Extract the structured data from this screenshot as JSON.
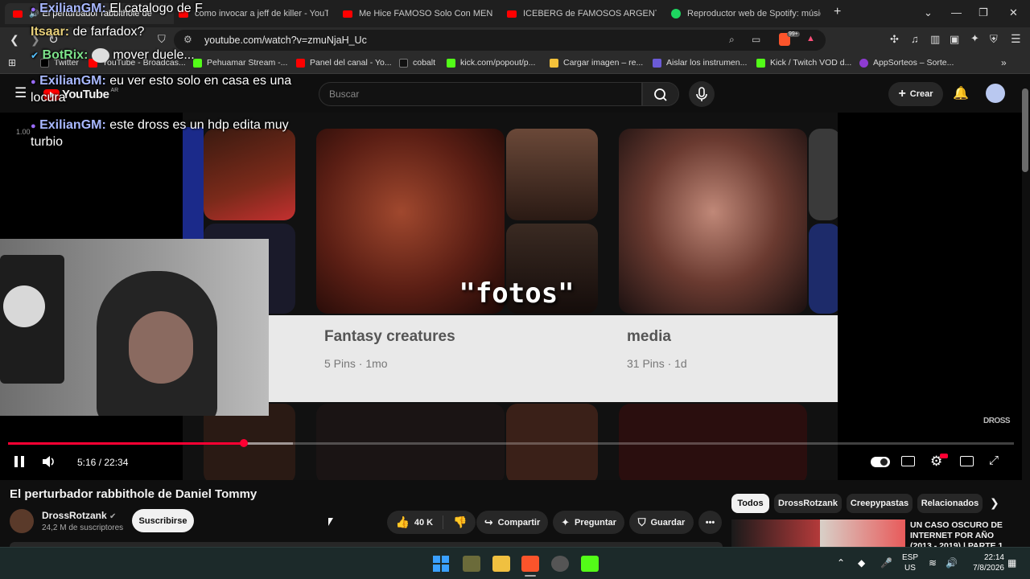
{
  "browser": {
    "tabs": [
      {
        "label": "El perturbador rabbithole de",
        "active": true
      },
      {
        "label": "como invocar a jeff de killer - YouTub",
        "active": false
      },
      {
        "label": "Me Hice FAMOSO Solo Con MENTIR",
        "active": false
      },
      {
        "label": "ICEBERG de FAMOSOS ARGENTINOS",
        "active": false
      },
      {
        "label": "Reproductor web de Spotify: música",
        "active": false
      }
    ],
    "url": "youtube.com/watch?v=zmuNjaH_Uc",
    "bookmarks": [
      "Twitter",
      "YouTube - Broadcas...",
      "Pehuamar Stream -...",
      "Panel del canal - Yo...",
      "cobalt",
      "kick.com/popout/p...",
      "Cargar imagen – re...",
      "Aislar los instrumen...",
      "Kick / Twitch VOD d...",
      "AppSorteos – Sorte..."
    ],
    "extension_badge": "99+"
  },
  "youtube": {
    "logo_text": "YouTube",
    "logo_country": "AR",
    "search_placeholder": "Buscar",
    "create_label": "Crear"
  },
  "chat_overlay": [
    {
      "user": "ExilianGM",
      "text": "El catalogo de F"
    },
    {
      "user": "Itsaar",
      "text": "de farfadox?"
    },
    {
      "user": "BotRix",
      "text": "mover duele..."
    },
    {
      "user": "ExilianGM",
      "text": "eu ver esto solo en casa es una",
      "text2": "locura"
    },
    {
      "user": "ExilianGM",
      "text": "este dross es un hdp edita muy",
      "text2": "turbio"
    }
  ],
  "overlay_scale": "1.00",
  "video": {
    "caption": "\"fotos\"",
    "board1_name": "Fantasy creatures",
    "board1_meta": "5 Pins · 1mo",
    "board2_name": "media",
    "board2_meta": "31 Pins · 1d",
    "watermark": "DROSS",
    "time": "5:16 / 22:34",
    "progress_fraction": 0.2347,
    "buffered_fraction": 0.2835
  },
  "details": {
    "title": "El perturbador rabbithole de Daniel Tommy",
    "channel": "DrossRotzank",
    "subscribers": "24,2 M de suscriptores",
    "subscribe_label": "Suscribirse",
    "likes": "40 K",
    "share_label": "Compartir",
    "ask_label": "Preguntar",
    "save_label": "Guardar"
  },
  "chips": [
    "Todos",
    "DrossRotzank",
    "Creepypastas",
    "Relacionados"
  ],
  "related": {
    "title": "UN CASO OSCURO DE INTERNET POR AÑO (2013 - 2019) | PARTE 1"
  },
  "taskbar": {
    "lang": "ESP",
    "lang2": "US",
    "clock_time": "22:14",
    "clock_date": "7/8/2026"
  },
  "colors": {
    "youtube_red": "#ff0033",
    "background": "#0f0f0f",
    "chip_bg": "#272727"
  }
}
